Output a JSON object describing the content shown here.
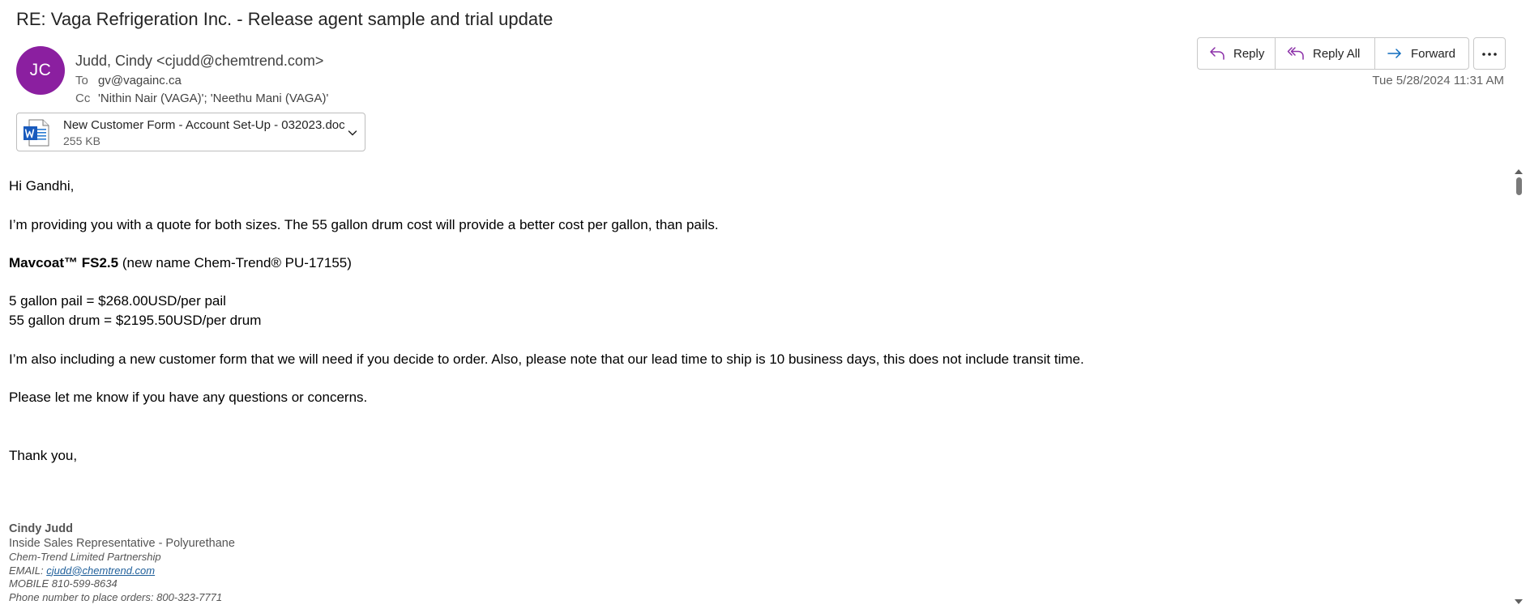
{
  "subject": "RE: Vaga Refrigeration Inc. - Release agent sample and trial update",
  "sender": {
    "initials": "JC",
    "display": "Judd, Cindy <cjudd@chemtrend.com>",
    "avatar_color": "#8b1fa0"
  },
  "recipients": {
    "to_label": "To",
    "to_value": "gv@vagainc.ca",
    "cc_label": "Cc",
    "cc_value": "'Nithin Nair (VAGA)'; 'Neethu Mani (VAGA)'"
  },
  "actions": {
    "reply": "Reply",
    "reply_all": "Reply All",
    "forward": "Forward",
    "more_icon": "ellipsis-icon"
  },
  "timestamp": "Tue 5/28/2024 11:31 AM",
  "attachment": {
    "name": "New Customer Form - Account Set-Up - 032023.doc",
    "size": "255 KB",
    "icon": "word-document-icon"
  },
  "body": {
    "greeting": "Hi Gandhi,",
    "para1": "I’m providing you with a quote for both sizes.  The 55 gallon drum cost will provide a better cost per gallon, than pails.",
    "product_bold": "Mavcoat™ FS2.5",
    "product_rest": " (new name Chem-Trend® PU-17155)",
    "price1": "5 gallon pail = $268.00USD/per pail",
    "price2": "55 gallon drum = $2195.50USD/per drum",
    "para2": "I’m also including a new customer form that we will need if you decide to order.  Also, please note that our lead time to ship is 10 business days, this does not include transit time.",
    "para3": "Please let me know if you have any questions or concerns.",
    "closing": "Thank you,"
  },
  "signature": {
    "name": "Cindy Judd",
    "title": "Inside Sales Representative - Polyurethane",
    "company": "Chem-Trend Limited Partnership",
    "email_label": "EMAIL: ",
    "email": "cjudd@chemtrend.com",
    "mobile": "MOBILE 810-599-8634",
    "orders": "Phone number to place orders: 800-323-7771"
  },
  "colors": {
    "reply_icon": "#8b2fa8",
    "forward_icon": "#0f6cbd",
    "link": "#1f5f9a"
  }
}
